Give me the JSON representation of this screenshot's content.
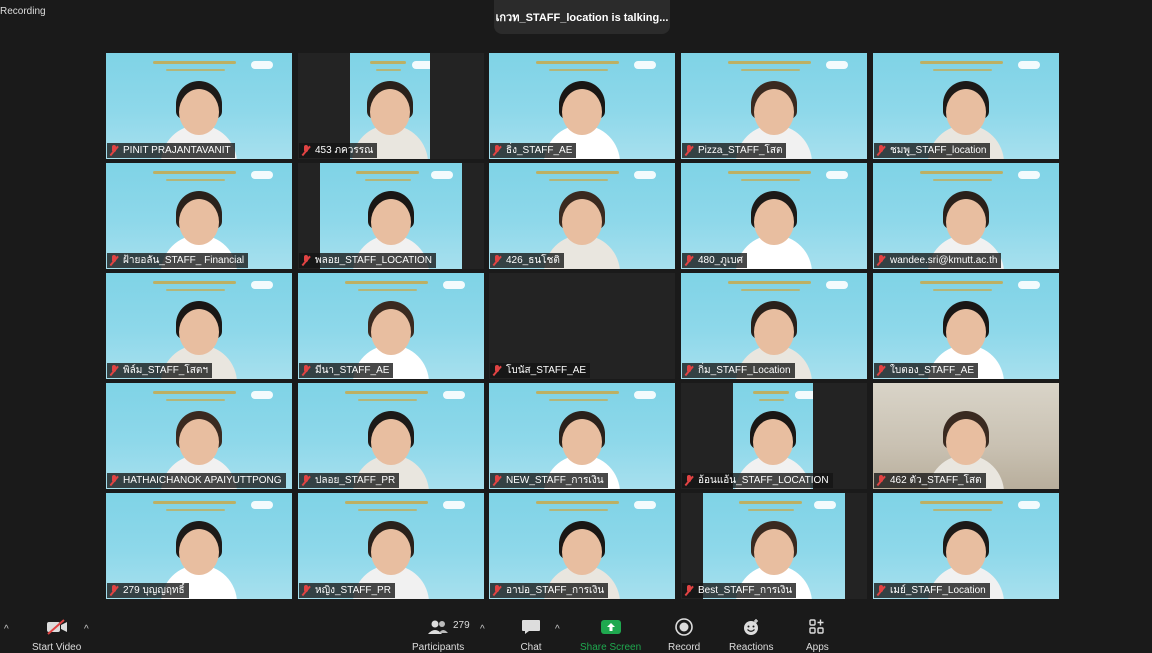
{
  "status": {
    "recording": "Recording",
    "talking": "เกวท_STAFF_location  is  talking..."
  },
  "participants": [
    {
      "name": "PINIT PRAJANTAVANIT",
      "muted": true
    },
    {
      "name": "453 ภควรรณ",
      "muted": true
    },
    {
      "name": "ธิ่ง_STAFF_AE",
      "muted": true
    },
    {
      "name": "Pizza_STAFF_โสต",
      "muted": true
    },
    {
      "name": "ชมพู_STAFF_location",
      "muted": true
    },
    {
      "name": "ฝ้ายอลัน_STAFF_ Financial",
      "muted": true
    },
    {
      "name": "พลอย_STAFF_LOCATION",
      "muted": true
    },
    {
      "name": "426_ธนโชติ",
      "muted": true
    },
    {
      "name": "480_ภูเบศ",
      "muted": true
    },
    {
      "name": "wandee.sri@kmutt.ac.th",
      "muted": true
    },
    {
      "name": "พิล์ม_STAFF_โสตฯ",
      "muted": true
    },
    {
      "name": "มีนา_STAFF_AE",
      "muted": true
    },
    {
      "name": "โบนัส_STAFF_AE",
      "muted": true
    },
    {
      "name": "กิ่ม_STAFF_Location",
      "muted": true
    },
    {
      "name": "ใบตอง_STAFF_AE",
      "muted": true
    },
    {
      "name": "HATHAICHANOK APAIYUTTPONG",
      "muted": true
    },
    {
      "name": "ปลอย_STAFF_PR",
      "muted": true
    },
    {
      "name": "NEW_STAFF_การเงิน",
      "muted": true
    },
    {
      "name": "อ้อนแอ้น_STAFF_LOCATION",
      "muted": true
    },
    {
      "name": "462 ตัว_STAFF_โสต",
      "muted": true
    },
    {
      "name": "279 บุญญฤทธิ์",
      "muted": true
    },
    {
      "name": "หญิง_STAFF_PR",
      "muted": true
    },
    {
      "name": "อาปอ_STAFF_การเงิน",
      "muted": true
    },
    {
      "name": "Best_STAFF_การเงิน",
      "muted": true
    },
    {
      "name": "เมย์_STAFF_Location",
      "muted": true
    }
  ],
  "toolbar": {
    "start_video": "Start Video",
    "video_icon": "video-off-icon",
    "participants_label": "Participants",
    "participants_count": "279",
    "chat": "Chat",
    "share_screen": "Share Screen",
    "share_color": "#1fa84f",
    "record": "Record",
    "reactions": "Reactions",
    "apps": "Apps"
  }
}
